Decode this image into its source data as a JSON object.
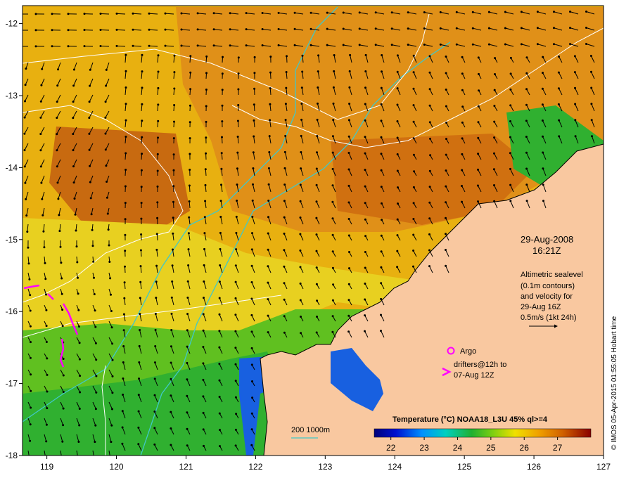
{
  "map": {
    "lon_ticks": [
      "119",
      "120",
      "121",
      "122",
      "123",
      "124",
      "125",
      "126",
      "127"
    ],
    "lat_ticks": [
      "-12",
      "-13",
      "-14",
      "-15",
      "-16",
      "-17",
      "-18"
    ],
    "lon_range": [
      118.65,
      127
    ],
    "lat_range": [
      -18,
      -11.75
    ]
  },
  "annotation": {
    "date": "29-Aug-2008",
    "time": "16:21Z",
    "altimetry_lines": [
      "Altimetric sealevel",
      "(0.1m contours)",
      "and velocity for",
      "29-Aug 16Z",
      "0.5m/s (1kt 24h)"
    ]
  },
  "legend": {
    "argo_label": "Argo",
    "drifters_line1": "drifters@12h to",
    "drifters_line2": "07-Aug 12Z",
    "isobath_label": "200  1000m"
  },
  "colorbar": {
    "title": "Temperature (°C) NOAA18_L3U 45% ql>=4",
    "ticks": [
      "22",
      "23",
      "24",
      "25",
      "26",
      "27"
    ],
    "range": [
      21.5,
      28
    ]
  },
  "credit": "© IMOS 05-Apr-2015 01:55:05 Hobart time",
  "colors": {
    "land": "#f9c8a0",
    "isobath": "#40c8c8",
    "sealevel_contour": "#ffffff",
    "drifter": "#ff00ff",
    "argo": "#ff00ff"
  }
}
